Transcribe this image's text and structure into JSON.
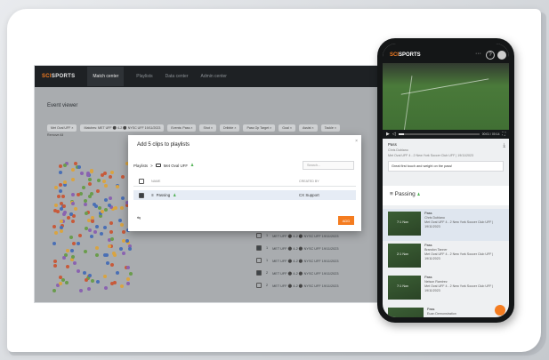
{
  "app": {
    "brand_prefix": "SCI",
    "brand_suffix": "SPORTS",
    "nav": [
      {
        "label": "Match center"
      },
      {
        "label": "Playlists"
      },
      {
        "label": "Data center"
      },
      {
        "label": "Admin center"
      }
    ],
    "page_title": "Event viewer",
    "filters": [
      "Met Oval UFF ×",
      "Matches: MET UFF ⚫ 4-2 ⚫ NYSC UFF 19/11/2023",
      "Events: Pass ×",
      "Shot ×",
      "Dribble ×",
      "Pass Op Target ×",
      "Goal ×",
      "Assist ×",
      "Tackle ×"
    ],
    "remove_all": "Remove All",
    "events": [
      {
        "num": "1",
        "match": "MET UFF ⚫ 4-2 ⚫ NYSC UFF 19/11/2023"
      },
      {
        "num": "1",
        "match": "MET UFF ⚫ 4-2 ⚫ NYSC UFF 19/11/2023"
      },
      {
        "num": "1",
        "match": "MET UFF ⚫ 4-2 ⚫ NYSC UFF 19/11/2023"
      },
      {
        "num": "2",
        "match": "MET UFF ⚫ 4-2 ⚫ NYSC UFF 19/11/2023"
      },
      {
        "num": "2",
        "match": "MET UFF ⚫ 4-2 ⚫ NYSC UFF 19/11/2023"
      }
    ]
  },
  "modal": {
    "title": "Add 5 clips to playlists",
    "close": "×",
    "crumb_root": "Playlists",
    "crumb_sep": ">",
    "crumb_folder": "Met Oval UFF",
    "search_placeholder": "Search...",
    "col_name": "NAME",
    "col_created": "CREATED BY",
    "row_name": "Passing",
    "row_created": "CX Support",
    "footer_icon": "⇋",
    "add_label": "ADD"
  },
  "phone": {
    "brand_prefix": "SCI",
    "brand_suffix": "SPORTS",
    "more": "···",
    "help": "?",
    "time": "00:01 / 00:14",
    "clip_title": "Pass",
    "clip_player": "Chris Dublano",
    "clip_match": "Met Oval UFF 4 - 2 New York Soccer Club UFF | 19/11/2023",
    "comment": "Great first touch and weight on the pass!",
    "playlist_title": "Passing",
    "items": [
      {
        "title": "Pass",
        "player": "Chris Dublano",
        "match": "Met Oval UFF 4 - 2 New York Soccer Club UFF | 19/11/2023",
        "dur": "7:1 Nov"
      },
      {
        "title": "Pass",
        "player": "Brandon Tanner",
        "match": "Met Oval UFF 4 - 2 New York Soccer Club UFF | 19/11/2023",
        "dur": "2:1 Nov"
      },
      {
        "title": "Pass",
        "player": "Nelson Ramirez",
        "match": "Met Oval UFF 4 - 2 New York Soccer Club UFF | 19/11/2023",
        "dur": "7:1 Nov"
      },
      {
        "title": "Pass",
        "player": "Euan Demonstration",
        "match": "",
        "dur": ""
      }
    ],
    "progress_fraction": 0.07
  },
  "colors": {
    "accent": "#f47c20",
    "nav_bg": "#1e2124",
    "highlight_row": "#e6ecf5"
  }
}
